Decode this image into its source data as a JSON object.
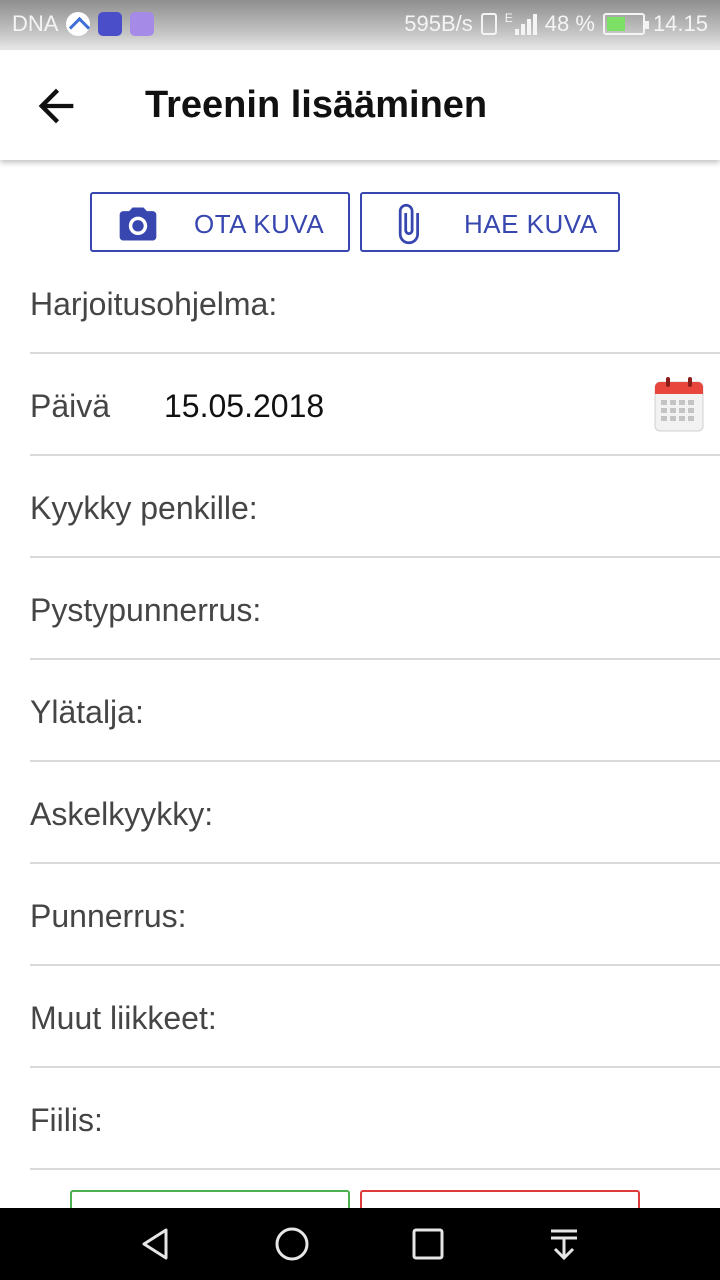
{
  "status_bar": {
    "carrier": "DNA",
    "net_speed": "595B/s",
    "network_type": "E",
    "battery": "48 %",
    "time": "14.15"
  },
  "header": {
    "title": "Treenin lisääminen",
    "back_icon": "arrow-back-icon"
  },
  "media_buttons": {
    "camera": {
      "label": "OTA KUVA",
      "icon": "camera-icon"
    },
    "gallery": {
      "label": "HAE KUVA",
      "icon": "paperclip-icon"
    }
  },
  "form": {
    "program": {
      "label": "Harjoitusohjelma:"
    },
    "date": {
      "label": "Päivä",
      "value": "15.05.2018",
      "icon": "calendar-icon"
    },
    "squat_bench": {
      "label": "Kyykky penkille:"
    },
    "overhead_press": {
      "label": "Pystypunnerrus:"
    },
    "lat_pulldown": {
      "label": "Ylätalja:"
    },
    "lunge": {
      "label": "Askelkyykky:"
    },
    "pushup": {
      "label": "Punnerrus:"
    },
    "other_moves": {
      "label": "Muut liikkeet:"
    },
    "feeling": {
      "label": "Fiilis:"
    }
  },
  "colors": {
    "accent": "#3847b0",
    "save_border": "#4caf50",
    "cancel_border": "#e03b3b",
    "calendar_red": "#e8453c"
  }
}
